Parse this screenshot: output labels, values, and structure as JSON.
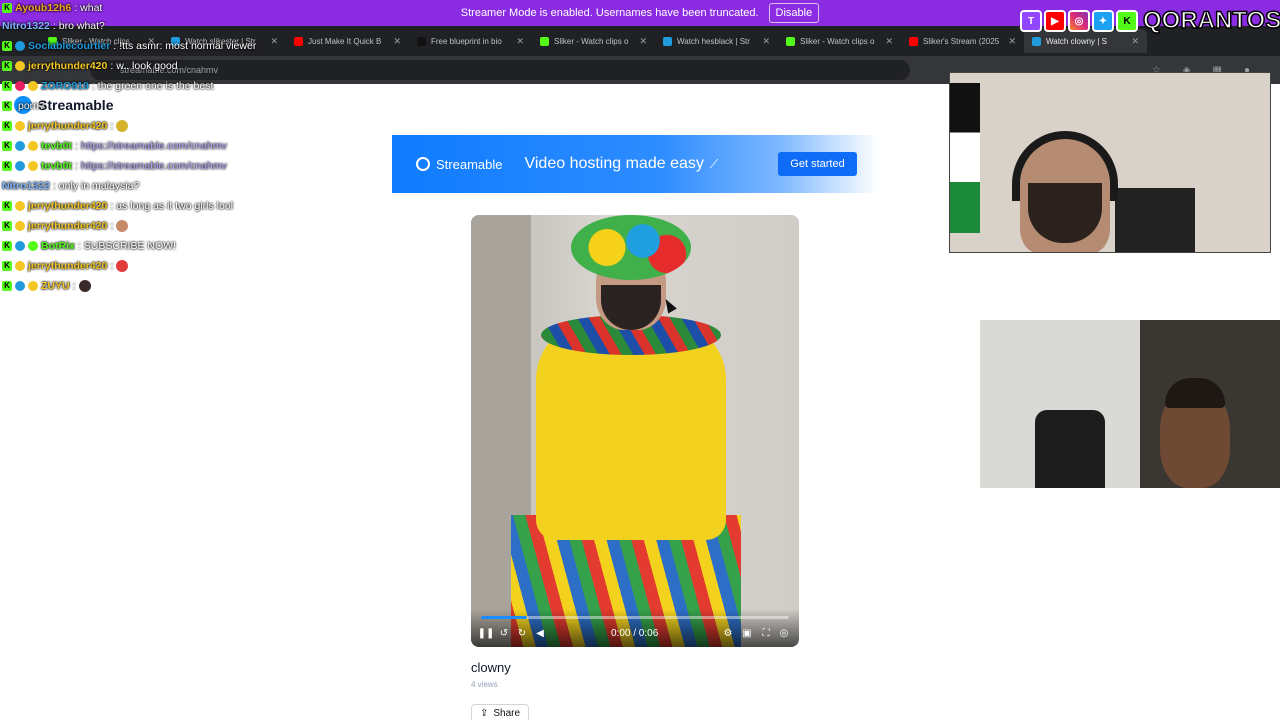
{
  "streamer_bar": {
    "message": "Streamer Mode is enabled. Usernames have been truncated.",
    "disable_label": "Disable"
  },
  "tabs": [
    {
      "label": "Sliker - Watch clips",
      "color": "#53fc18"
    },
    {
      "label": "Watch slikester | Str",
      "color": "#1f9bde"
    },
    {
      "label": "Just Make It Quick B",
      "color": "#ff0000"
    },
    {
      "label": "Free blueprint in bio",
      "color": "#111111"
    },
    {
      "label": "Sliker - Watch clips o",
      "color": "#53fc18"
    },
    {
      "label": "Watch hesblack | Str",
      "color": "#1f9bde"
    },
    {
      "label": "Sliker - Watch clips o",
      "color": "#53fc18"
    },
    {
      "label": "Sliker's Stream (2025",
      "color": "#ff0000"
    },
    {
      "label": "Watch clowny | S",
      "color": "#1f9bde"
    }
  ],
  "address": "streamable.com/cnahmv",
  "chat": [
    {
      "user": "Ayoub12h6",
      "user_color": "#f5a623",
      "msg": "what"
    },
    {
      "user": "Nitro1322",
      "user_color": "#7fb4ff",
      "msg": "bro what?"
    },
    {
      "user": "Sociablecourtier",
      "user_color": "#1f9bde",
      "msg": "!tts asmr: most normal viewer"
    },
    {
      "user": "jerrythunder420",
      "user_color": "#f3c623",
      "msg": "w.. look good"
    },
    {
      "user": "ZORO919",
      "user_color": "#1f9bde",
      "msg": "the green one is the best"
    },
    {
      "user": "",
      "user_color": "#ffffff",
      "msg": "porn?"
    },
    {
      "user": "jerrythunder420",
      "user_color": "#f3c623",
      "msg": ""
    },
    {
      "user": "tevb0t",
      "user_color": "#53fc18",
      "msg": "https://streamable.com/cnahmv",
      "link": true
    },
    {
      "user": "tevb0t",
      "user_color": "#53fc18",
      "msg": "https://streamable.com/cnahmv",
      "link": true
    },
    {
      "user": "Nitro1322",
      "user_color": "#7fb4ff",
      "msg": "only in malaysia?"
    },
    {
      "user": "jerrythunder420",
      "user_color": "#f3c623",
      "msg": "as long as it two girls lool"
    },
    {
      "user": "jerrythunder420",
      "user_color": "#f3c623",
      "msg": ""
    },
    {
      "user": "BotRix",
      "user_color": "#53fc18",
      "msg": "SUBSCRIBE NOW!"
    },
    {
      "user": "jerrythunder420",
      "user_color": "#f3c623",
      "msg": ""
    },
    {
      "user": "ZUYU",
      "user_color": "#f3c623",
      "msg": ""
    }
  ],
  "page": {
    "logo": "Streamable",
    "banner": {
      "logo": "Streamable",
      "tagline": "Video hosting made easy",
      "cta": "Get started"
    },
    "video": {
      "time": "0:00 / 0:06",
      "progress": 0.15
    },
    "title": "clowny",
    "views": "4 views",
    "share": "Share"
  },
  "social": {
    "handle": "QORANTOS",
    "icons": [
      "twitch-icon",
      "youtube-icon",
      "instagram-icon",
      "x-icon",
      "kick-icon"
    ]
  }
}
